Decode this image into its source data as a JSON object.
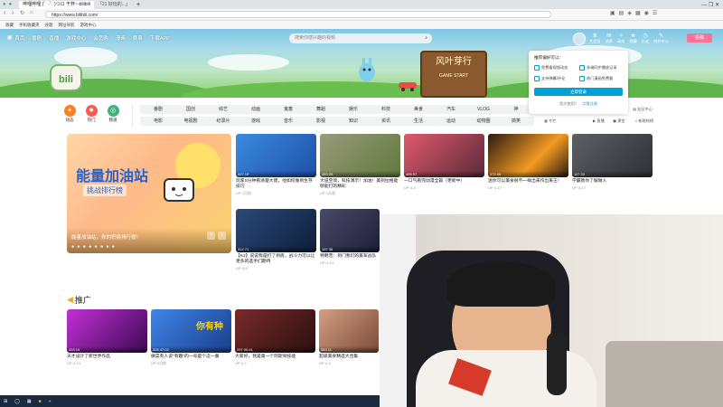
{
  "browser": {
    "tabs": [
      "哔哩哔哩 (゜-゜)つロ 干杯~-bilibili",
      "「21 好玩的...」"
    ],
    "url": "https://www.bilibili.com/",
    "bookmarks": [
      "收藏",
      "手机收藏夹",
      "谷歌",
      "网址导航",
      "游戏中心"
    ]
  },
  "site": {
    "nav": [
      "首页",
      "番剧",
      "直播",
      "游戏中心",
      "会员购",
      "漫画",
      "赛事",
      "下载APP"
    ],
    "search_placeholder": "搜索你感兴趣的视频",
    "right_nav": [
      "大会员",
      "消息",
      "动态",
      "收藏",
      "历史",
      "创作中心"
    ],
    "upload": "投稿",
    "banner_sign": "风叶芽行",
    "banner_sign_sub": "GAME START"
  },
  "quick_icons": [
    {
      "label": "动态",
      "color": "#ff7f24",
      "glyph": "✦"
    },
    {
      "label": "热门",
      "color": "#f85a54",
      "glyph": "✹"
    },
    {
      "label": "频道",
      "color": "#3fb27f",
      "glyph": "◎"
    }
  ],
  "categories": [
    [
      "番剧",
      "国创",
      "综艺",
      "动画",
      "鬼畜",
      "舞蹈",
      "娱乐",
      "科技",
      "美食",
      "汽车",
      "VLOG",
      "神"
    ],
    [
      "电影",
      "电视剧",
      "纪录片",
      "游戏",
      "音乐",
      "影视",
      "知识",
      "资讯",
      "生活",
      "运动",
      "动物圈",
      "搞笑"
    ]
  ],
  "popup": {
    "title": "推荐偏好可以：",
    "options": [
      "免费看视频动态",
      "多端同步播放记录",
      "支持弹幕/评论",
      "热门漫画免费看"
    ],
    "button": "立即登录",
    "footer_left": "首次使用？",
    "footer_link": "点我注册"
  },
  "right_links": [
    "专栏",
    "直播",
    "课堂",
    "社区中心",
    "新歌热榜"
  ],
  "hero": {
    "title": "能量加油站",
    "subtitle": "挑战排行榜",
    "caption": "能量加油站，你的积极排行榜！"
  },
  "cards": [
    {
      "title": "玩家S分钟看清楚大佬，他如何做到生存技巧",
      "author": "UP·1月前",
      "meta": "427   19",
      "color": "#2a7ad9"
    },
    {
      "title": "大道至简，科技演示！加油！美到拉格能够能打的精彩",
      "author": "UP·3天前",
      "meta": "283   25",
      "color": "#6b8c4c"
    },
    {
      "title": "一口气看完动漫全篇（更新中）",
      "author": "UP·4-3",
      "meta": "405   57",
      "color": "#b8394e"
    },
    {
      "title": "迷你可以美食很不一样出来作出来王！",
      "author": "UP·4-17",
      "meta": "372   09",
      "color": "#f39b23"
    },
    {
      "title": "学霸教你了解做人",
      "author": "UP·4-17",
      "meta": "117   20",
      "color": "#4c4f55"
    },
    {
      "title": "【K2】说说我是打了到底，战斗力可以让更多的选手们期待",
      "author": "UP·4-6",
      "meta": "314   71",
      "color": "#2a4a7a"
    },
    {
      "title": "特朗普：到门我们的美军战队",
      "author": "UP·4-13",
      "meta": "197   36",
      "color": "#3a3a52"
    }
  ],
  "promo": {
    "heading": "推广",
    "cards": [
      {
        "title": "天才设计了新世界作品",
        "author": "UP·4-13",
        "color": "#8a2bc0",
        "meta": "333   10"
      },
      {
        "title": "做菜有人说\"有趣\"的一号是个这一餐",
        "author": "UP·3月前",
        "color": "#2c6ac9",
        "meta": "325   47:02",
        "overlay": "你有种"
      },
      {
        "title": "大家好，我是第一个阿斯顿技能",
        "author": "UP·4-7",
        "color": "#6c2a2a",
        "meta": "297   00:41"
      },
      {
        "title": "超级美食精选大合集",
        "author": "UP·4-3",
        "color": "#b87b5e",
        "meta": "353   11"
      }
    ]
  },
  "taskbar": {
    "time": ""
  }
}
